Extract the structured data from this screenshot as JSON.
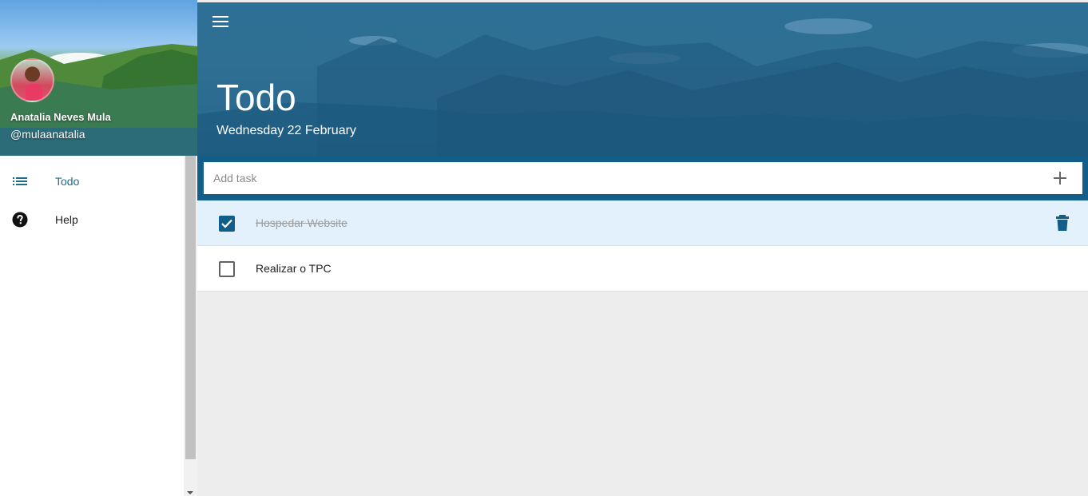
{
  "profile": {
    "name": "Anatalia Neves Mula",
    "handle": "@mulaanatalia"
  },
  "nav": {
    "items": [
      {
        "label": "Todo",
        "icon": "list-icon",
        "active": true
      },
      {
        "label": "Help",
        "icon": "help-icon",
        "active": false
      }
    ]
  },
  "header": {
    "title": "Todo",
    "date": "Wednesday 22 February"
  },
  "add_task": {
    "placeholder": "Add task",
    "value": ""
  },
  "tasks": [
    {
      "text": "Hospedar Website",
      "done": true
    },
    {
      "text": "Realizar o TPC",
      "done": false
    }
  ],
  "colors": {
    "accent": "#125e8a",
    "active_nav_text": "#1d6c8c",
    "done_row_bg": "#e3f1fc",
    "background": "#ededed"
  }
}
